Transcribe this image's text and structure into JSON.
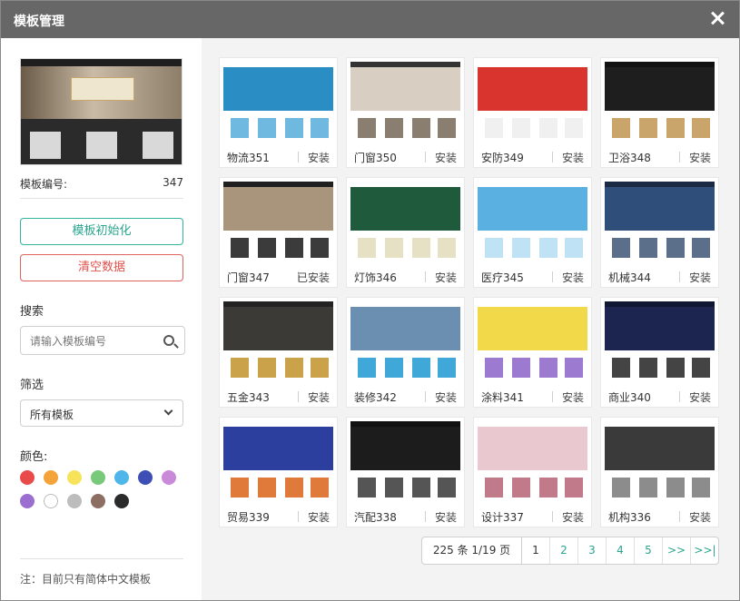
{
  "dialog": {
    "title": "模板管理"
  },
  "sidebar": {
    "template_number_label": "模板编号:",
    "template_number_value": "347",
    "init_button": "模板初始化",
    "clear_button": "清空数据",
    "search_label": "搜索",
    "search_placeholder": "请输入模板编号",
    "filter_label": "筛选",
    "filter_selected": "所有模板",
    "color_label": "颜色:",
    "colors": [
      "#e94b4b",
      "#f3a33a",
      "#f7e35a",
      "#78c97a",
      "#4fb6ea",
      "#3d4fb5",
      "#c98bd9",
      "#9b6fd0",
      "#ffffff",
      "#bdbdbd",
      "#8d6e63",
      "#2b2b2b"
    ],
    "note": "注：目前只有简体中文模板"
  },
  "templates": [
    {
      "name": "物流351",
      "action": "安装",
      "theme": {
        "nav": "#ffffff",
        "hero": "#2a8ec4",
        "accent": "#6fb8e0"
      }
    },
    {
      "name": "门窗350",
      "action": "安装",
      "theme": {
        "nav": "#333333",
        "hero": "#d8cfc2",
        "accent": "#8a7e70"
      }
    },
    {
      "name": "安防349",
      "action": "安装",
      "theme": {
        "nav": "#ffffff",
        "hero": "#d9352e",
        "accent": "#f0f0f0"
      }
    },
    {
      "name": "卫浴348",
      "action": "安装",
      "theme": {
        "nav": "#111111",
        "hero": "#1e1e1e",
        "accent": "#c9a56b"
      }
    },
    {
      "name": "门窗347",
      "action": "已安装",
      "theme": {
        "nav": "#1f1f1f",
        "hero": "#a8957c",
        "accent": "#3b3b3b"
      }
    },
    {
      "name": "灯饰346",
      "action": "安装",
      "theme": {
        "nav": "#ffffff",
        "hero": "#1f5a3c",
        "accent": "#e6e0c4"
      }
    },
    {
      "name": "医疗345",
      "action": "安装",
      "theme": {
        "nav": "#ffffff",
        "hero": "#5ab0e0",
        "accent": "#bfe3f5"
      }
    },
    {
      "name": "机械344",
      "action": "安装",
      "theme": {
        "nav": "#1a2a45",
        "hero": "#2f4e7a",
        "accent": "#5b6f8a"
      }
    },
    {
      "name": "五金343",
      "action": "安装",
      "theme": {
        "nav": "#222222",
        "hero": "#3b3a36",
        "accent": "#c9a24a"
      }
    },
    {
      "name": "装修342",
      "action": "安装",
      "theme": {
        "nav": "#ffffff",
        "hero": "#6b8fb0",
        "accent": "#3fa8d8"
      }
    },
    {
      "name": "涂料341",
      "action": "安装",
      "theme": {
        "nav": "#ffffff",
        "hero": "#f2d94a",
        "accent": "#9b7ad0"
      }
    },
    {
      "name": "商业340",
      "action": "安装",
      "theme": {
        "nav": "#0f1733",
        "hero": "#1b2550",
        "accent": "#444444"
      }
    },
    {
      "name": "贸易339",
      "action": "安装",
      "theme": {
        "nav": "#ffffff",
        "hero": "#2c3e9e",
        "accent": "#e07a3a"
      }
    },
    {
      "name": "汽配338",
      "action": "安装",
      "theme": {
        "nav": "#111111",
        "hero": "#1c1c1c",
        "accent": "#555555"
      }
    },
    {
      "name": "设计337",
      "action": "安装",
      "theme": {
        "nav": "#ffffff",
        "hero": "#e9c9cf",
        "accent": "#c07a8a"
      }
    },
    {
      "name": "机构336",
      "action": "安装",
      "theme": {
        "nav": "#ffffff",
        "hero": "#3a3a3a",
        "accent": "#8c8c8c"
      }
    }
  ],
  "pagination": {
    "summary": "225 条 1/19 页",
    "pages": [
      "1",
      "2",
      "3",
      "4",
      "5"
    ],
    "next": ">>",
    "last": ">>|",
    "current": "1"
  }
}
